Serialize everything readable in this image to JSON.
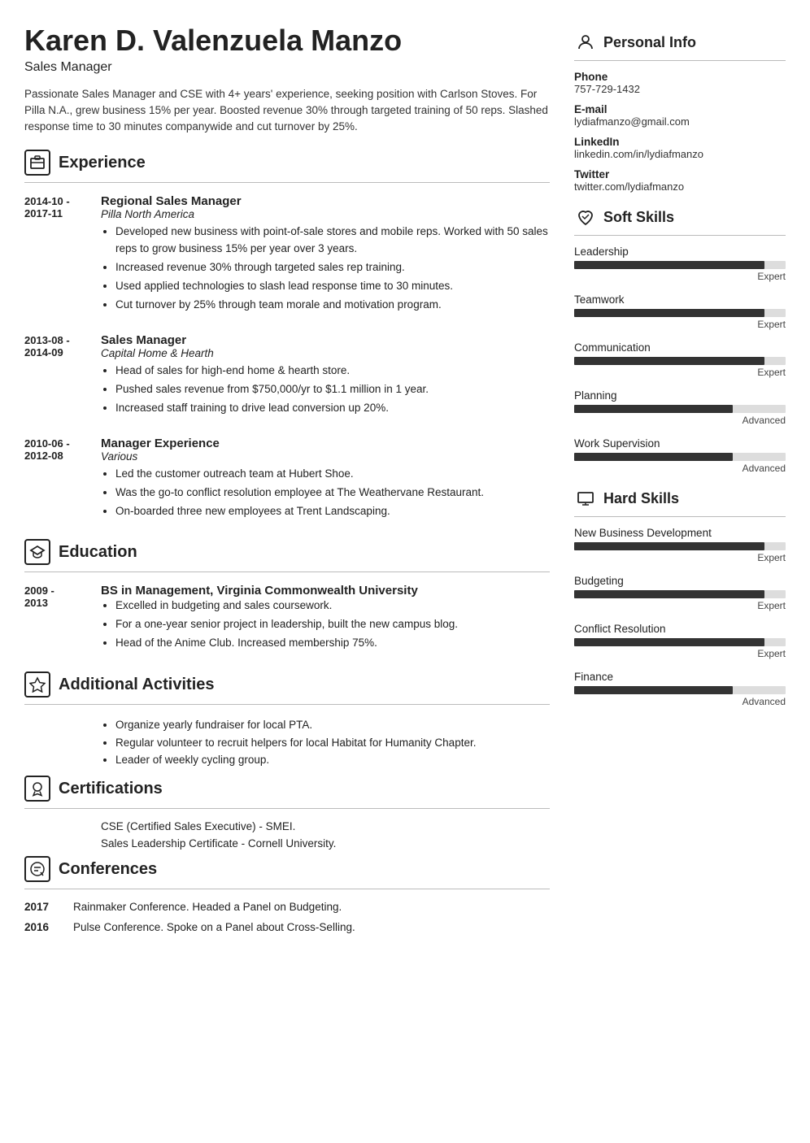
{
  "header": {
    "name": "Karen D. Valenzuela Manzo",
    "title": "Sales Manager",
    "summary": "Passionate Sales Manager and CSE with 4+ years' experience, seeking position with Carlson Stoves. For Pilla N.A., grew business 15% per year. Boosted revenue 30% through targeted training of 50 reps. Slashed response time to 30 minutes companywide and cut turnover by 25%."
  },
  "experience": {
    "section_label": "Experience",
    "entries": [
      {
        "date": "2014-10 -\n2017-11",
        "job_title": "Regional Sales Manager",
        "company": "Pilla North America",
        "bullets": [
          "Developed new business with point-of-sale stores and mobile reps. Worked with 50 sales reps to grow business 15% per year over 3 years.",
          "Increased revenue 30% through targeted sales rep training.",
          "Used applied technologies to slash lead response time to 30 minutes.",
          "Cut turnover by 25% through team morale and motivation program."
        ]
      },
      {
        "date": "2013-08 -\n2014-09",
        "job_title": "Sales Manager",
        "company": "Capital Home & Hearth",
        "bullets": [
          "Head of sales for high-end home & hearth store.",
          "Pushed sales revenue from $750,000/yr to $1.1 million in 1 year.",
          "Increased staff training to drive lead conversion up 20%."
        ]
      },
      {
        "date": "2010-06 -\n2012-08",
        "job_title": "Manager Experience",
        "company": "Various",
        "bullets": [
          "Led the customer outreach team at Hubert Shoe.",
          "Was the go-to conflict resolution employee at The Weathervane Restaurant.",
          "On-boarded three new employees at Trent Landscaping."
        ]
      }
    ]
  },
  "education": {
    "section_label": "Education",
    "entries": [
      {
        "date": "2009 -\n2013",
        "degree": "BS in Management, Virginia Commonwealth University",
        "bullets": [
          "Excelled in budgeting and sales coursework.",
          "For a one-year senior project in leadership, built the new campus blog.",
          "Head of the Anime Club. Increased membership 75%."
        ]
      }
    ]
  },
  "additional_activities": {
    "section_label": "Additional Activities",
    "bullets": [
      "Organize yearly fundraiser for local PTA.",
      "Regular volunteer to recruit helpers for local Habitat for Humanity Chapter.",
      "Leader of weekly cycling group."
    ]
  },
  "certifications": {
    "section_label": "Certifications",
    "items": [
      "CSE (Certified Sales Executive) - SMEI.",
      "Sales Leadership Certificate - Cornell University."
    ]
  },
  "conferences": {
    "section_label": "Conferences",
    "entries": [
      {
        "year": "2017",
        "description": "Rainmaker Conference. Headed a Panel on Budgeting."
      },
      {
        "year": "2016",
        "description": "Pulse Conference. Spoke on a Panel about Cross-Selling."
      }
    ]
  },
  "personal_info": {
    "section_label": "Personal Info",
    "items": [
      {
        "label": "Phone",
        "value": "757-729-1432"
      },
      {
        "label": "E-mail",
        "value": "lydiafmanzo@gmail.com"
      },
      {
        "label": "LinkedIn",
        "value": "linkedin.com/in/lydiafmanzo"
      },
      {
        "label": "Twitter",
        "value": "twitter.com/lydiafmanzo"
      }
    ]
  },
  "soft_skills": {
    "section_label": "Soft Skills",
    "items": [
      {
        "name": "Leadership",
        "percent": 90,
        "level": "Expert"
      },
      {
        "name": "Teamwork",
        "percent": 90,
        "level": "Expert"
      },
      {
        "name": "Communication",
        "percent": 90,
        "level": "Expert"
      },
      {
        "name": "Planning",
        "percent": 75,
        "level": "Advanced"
      },
      {
        "name": "Work Supervision",
        "percent": 75,
        "level": "Advanced"
      }
    ]
  },
  "hard_skills": {
    "section_label": "Hard Skills",
    "items": [
      {
        "name": "New Business Development",
        "percent": 90,
        "level": "Expert"
      },
      {
        "name": "Budgeting",
        "percent": 90,
        "level": "Expert"
      },
      {
        "name": "Conflict Resolution",
        "percent": 90,
        "level": "Expert"
      },
      {
        "name": "Finance",
        "percent": 75,
        "level": "Advanced"
      }
    ]
  },
  "icons": {
    "experience": "🗂",
    "education": "🎓",
    "additional": "⭐",
    "certifications": "🏅",
    "conferences": "💬",
    "personal_info": "👤",
    "soft_skills": "🤝",
    "hard_skills": "🖥"
  }
}
